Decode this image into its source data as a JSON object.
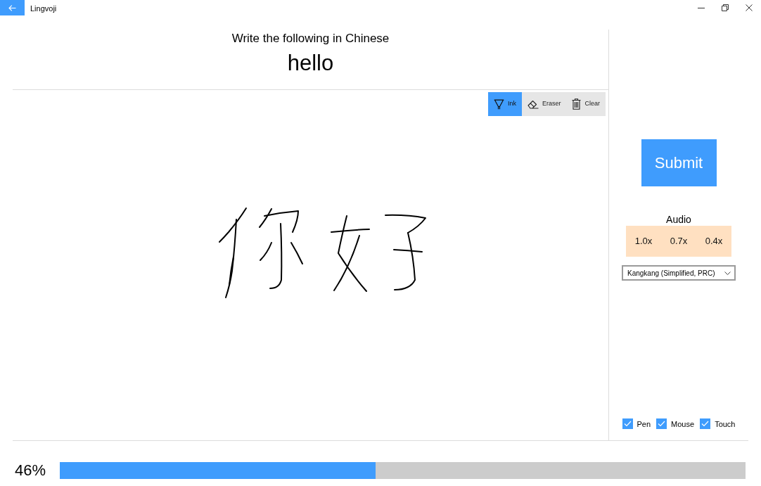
{
  "window": {
    "title": "Lingvoji"
  },
  "prompt": {
    "instruction": "Write the following in Chinese",
    "word": "hello"
  },
  "ink_toolbar": [
    {
      "kind": "ink",
      "label": "Ink",
      "selected": true
    },
    {
      "kind": "eraser",
      "label": "Eraser",
      "selected": false
    },
    {
      "kind": "clear",
      "label": "Clear",
      "selected": false
    }
  ],
  "submit_button": "Submit",
  "audio": {
    "label": "Audio",
    "speeds": [
      "1.0x",
      "0.7x",
      "0.4x"
    ],
    "voice": "Kangkang (Simplified, PRC)"
  },
  "input_modes": [
    {
      "label": "Pen",
      "checked": true
    },
    {
      "label": "Mouse",
      "checked": true
    },
    {
      "label": "Touch",
      "checked": true
    }
  ],
  "progress": {
    "reading": "46%",
    "level": 0.46
  }
}
